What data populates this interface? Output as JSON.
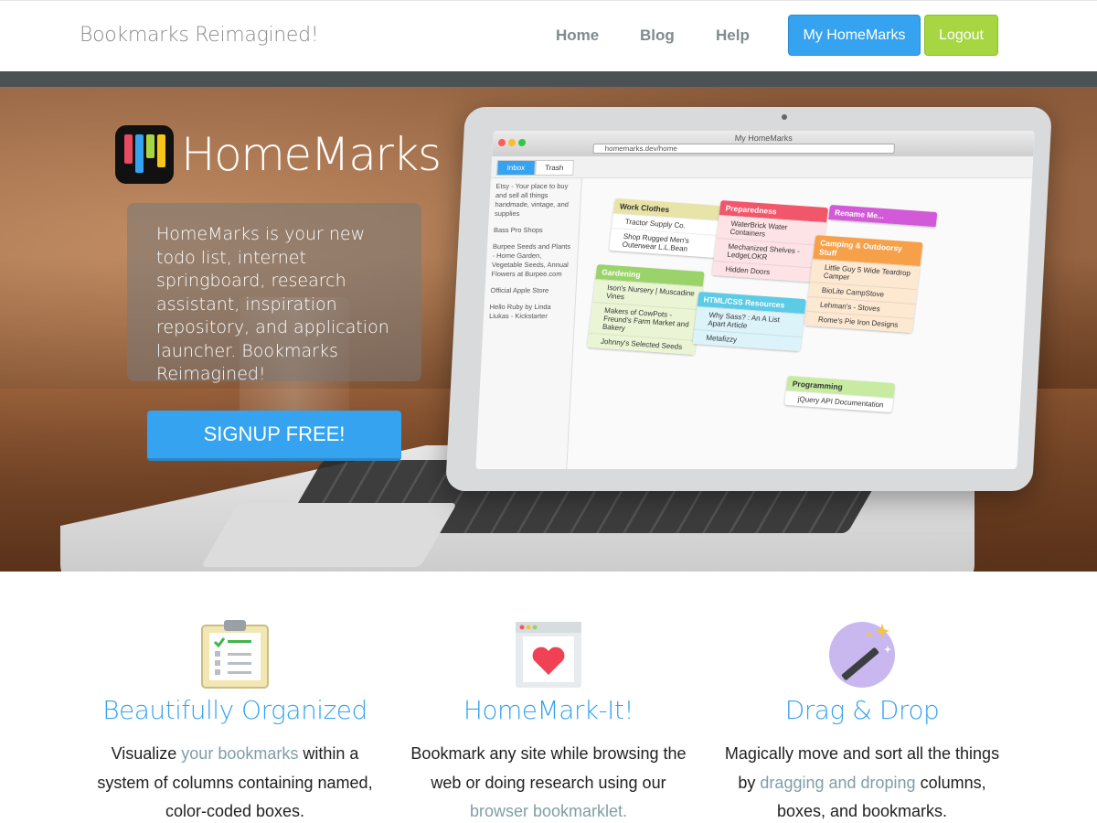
{
  "nav": {
    "brand": "Bookmarks Reimagined!",
    "links": [
      "Home",
      "Blog",
      "Help"
    ],
    "primary_button": "My HomeMarks",
    "secondary_button": "Logout"
  },
  "hero": {
    "logo_text": "HomeMarks",
    "tagline": "HomeMarks is your new todo list, internet springboard, research assistant, inspiration repository, and application launcher. Bookmarks Reimagined!",
    "cta": "SIGNUP FREE!"
  },
  "screen": {
    "window_title": "My HomeMarks",
    "url": "homemarks.dev/home",
    "tabs": [
      "Inbox",
      "Trash"
    ],
    "sidebar_items": [
      "Etsy - Your place to buy and sell all things handmade, vintage, and supplies",
      "Bass Pro Shops",
      "Burpee Seeds and Plants - Home Garden, Vegetable Seeds, Annual Flowers at Burpee.com",
      "Official Apple Store",
      "Hello Ruby by Linda Liukas - Kickstarter"
    ],
    "boxes": [
      {
        "title": "Work Clothes",
        "items": [
          "Tractor Supply Co.",
          "Shop Rugged Men's Outerwear L.L.Bean"
        ]
      },
      {
        "title": "Gardening",
        "items": [
          "Ison's Nursery | Muscadine Vines",
          "Makers of CowPots - Freund's Farm Market and Bakery",
          "Johnny's Selected Seeds"
        ]
      },
      {
        "title": "Preparedness",
        "items": [
          "WaterBrick Water Containers",
          "Mechanized Shelves - LedgeLOKR",
          "Hidden Doors"
        ]
      },
      {
        "title": "HTML/CSS Resources",
        "items": [
          "Why Sass? : An A List Apart Article",
          "Metafizzy"
        ]
      },
      {
        "title": "Rename Me...",
        "items": []
      },
      {
        "title": "Camping & Outdoorsy Stuff",
        "items": [
          "Little Guy 5 Wide Teardrop Camper",
          "BioLite CampStove",
          "Lehman's - Stoves",
          "Rome's Pie Iron Designs"
        ]
      },
      {
        "title": "Programming",
        "items": [
          "jQuery API Documentation"
        ]
      }
    ]
  },
  "features": [
    {
      "icon": "clipboard-icon",
      "title": "Beautifully Organized",
      "text_before": "Visualize ",
      "link": "your bookmarks",
      "text_after": " within a system of columns containing named, color-coded boxes."
    },
    {
      "icon": "heart-window-icon",
      "title": "HomeMark-It!",
      "text_before": "Bookmark any site while browsing the web or doing research using our ",
      "link": "browser bookmarklet.",
      "text_after": ""
    },
    {
      "icon": "magic-wand-icon",
      "title": "Drag & Drop",
      "text_before": "Magically move and sort all the things by ",
      "link": "dragging and droping",
      "text_after": " columns, boxes, and bookmarks."
    }
  ],
  "colors": {
    "accent_blue": "#35a3ef",
    "accent_green": "#a6d642",
    "nav_link": "#7f8c8d",
    "band": "#4a5256"
  }
}
